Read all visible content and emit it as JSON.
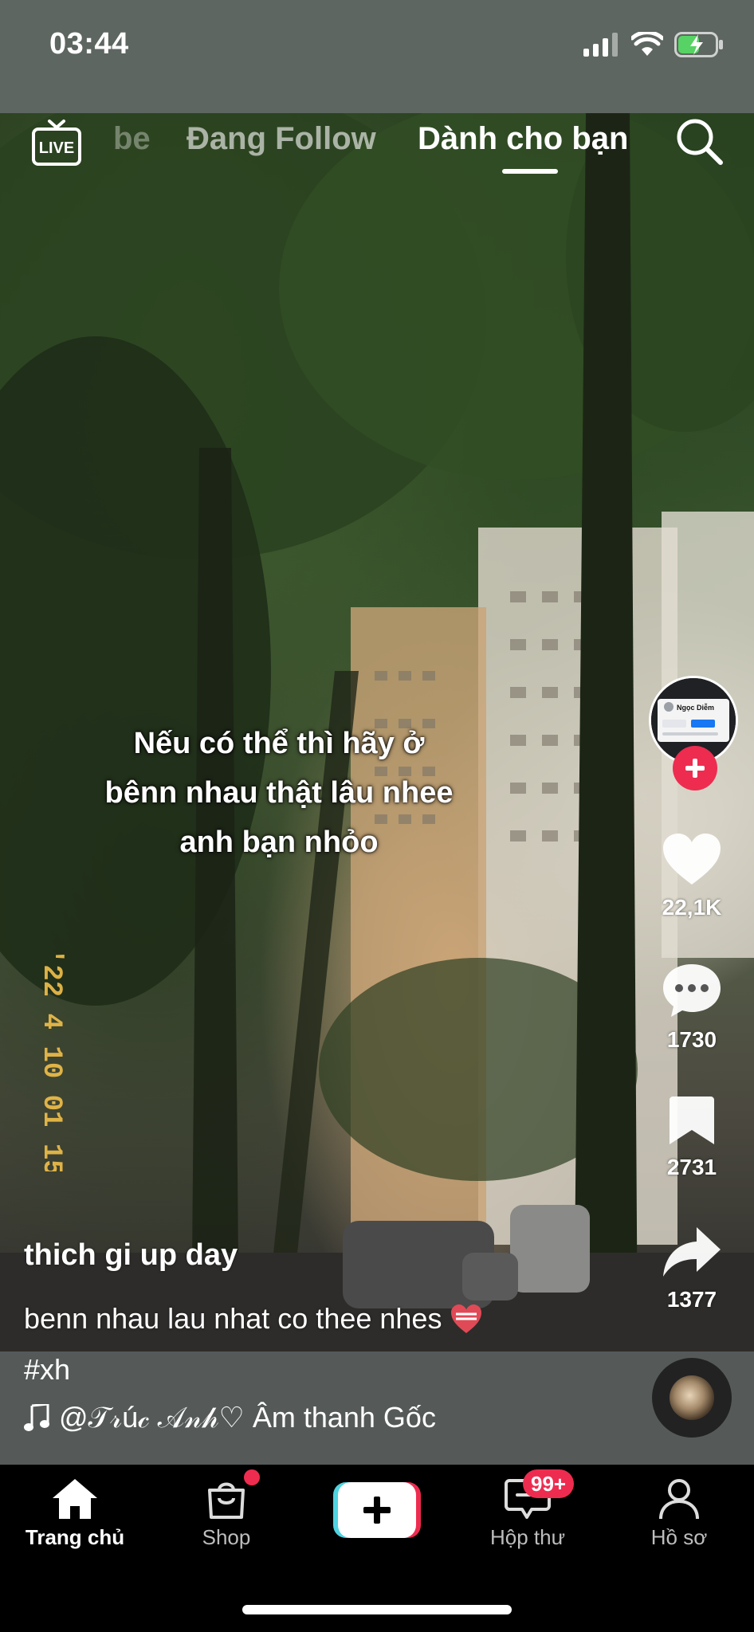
{
  "status_bar": {
    "time": "03:44",
    "icons": [
      "signal-icon",
      "wifi-icon",
      "battery-charging-icon"
    ]
  },
  "top_tabs": {
    "live_label": "LIVE",
    "ghost_tab": "be",
    "following": "Đang Follow",
    "for_you": "Dành cho bạn",
    "icons": [
      "live-icon",
      "search-icon"
    ]
  },
  "video": {
    "caption": "Nếu có thể thì hãy ở\nbênn nhau thật lâu nhee\nanh bạn nhỏo",
    "film_stamp": "'22 4 10 01 15 B"
  },
  "right_rail": {
    "avatar_name": "Ngọc Diễm",
    "likes": "22,1K",
    "comments": "1730",
    "saves": "2731",
    "shares": "1377",
    "icons": [
      "avatar",
      "plus-icon",
      "heart-icon",
      "comment-icon",
      "bookmark-icon",
      "share-icon"
    ]
  },
  "meta": {
    "author": "thich gi up day",
    "description": "benn nhau lau nhat co thee nhes",
    "hashtag": "#xh",
    "music": "@𝒯𝓇ú𝒸 𝒜𝓃𝒽♡ Âm thanh Gốc"
  },
  "bottom_nav": {
    "home": "Trang chủ",
    "shop": "Shop",
    "inbox": "Hộp thư",
    "profile": "Hồ sơ",
    "inbox_badge": "99+",
    "icons": [
      "home-icon",
      "shop-icon",
      "create-icon",
      "inbox-icon",
      "profile-icon"
    ]
  },
  "colors": {
    "accent": "#ee2c50",
    "status_bar_bg": "#5d6660",
    "info_strip_bg": "#555a59",
    "create_cyan": "#4fd3e0",
    "create_red": "#ee2c50"
  }
}
